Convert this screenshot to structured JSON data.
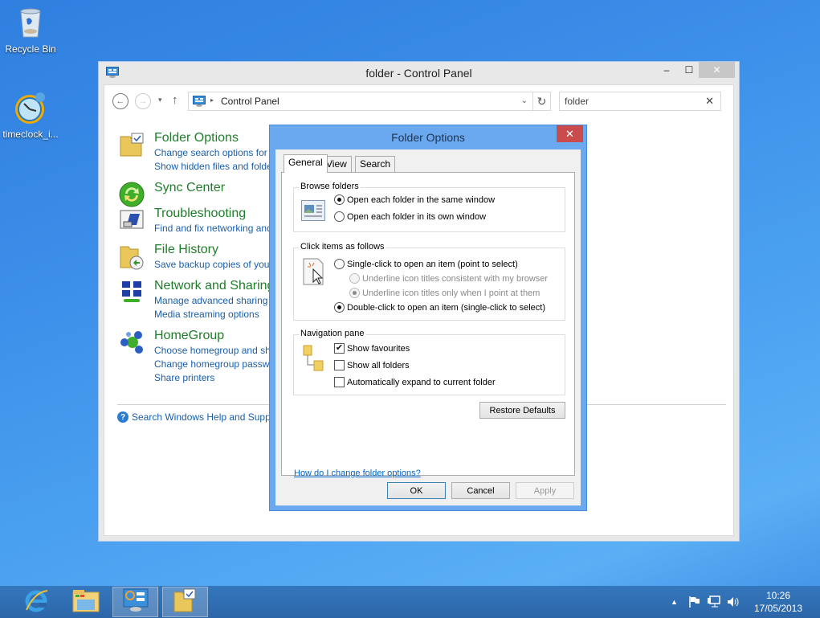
{
  "desktop": {
    "icons": [
      {
        "label": "Recycle Bin",
        "icon": "recycle-bin-icon"
      },
      {
        "label": "timeclock_i...",
        "icon": "clock-app-icon"
      }
    ]
  },
  "control_panel": {
    "title": "folder - Control Panel",
    "icon": "control-panel-icon",
    "window_buttons": {
      "minimize": "‒",
      "maximize": "☐",
      "close": "✕"
    },
    "nav": {
      "back": "←",
      "forward": "→",
      "recent": "▾",
      "up": "↑",
      "breadcrumb_sep": "▸",
      "address": "Control Panel",
      "address_dropdown": "⌄",
      "refresh": "↻"
    },
    "search": {
      "value": "folder",
      "clear": "✕"
    },
    "results": [
      {
        "title": "Folder Options",
        "icon": "folder-options-icon",
        "links": [
          "Change search options for files and folders",
          "Show hidden files and folders"
        ]
      },
      {
        "title": "Sync Center",
        "icon": "sync-center-icon",
        "links": []
      },
      {
        "title": "Troubleshooting",
        "icon": "troubleshooting-icon",
        "links": [
          "Find and fix networking and connection problems"
        ]
      },
      {
        "title": "File History",
        "icon": "file-history-icon",
        "links": [
          "Save backup copies of your files with File History"
        ]
      },
      {
        "title": "Network and Sharing Center",
        "icon": "network-sharing-icon",
        "links": [
          "Manage advanced sharing settings",
          "Media streaming options"
        ]
      },
      {
        "title": "HomeGroup",
        "icon": "homegroup-icon",
        "links": [
          "Choose homegroup and sharing options",
          "Change homegroup password",
          "Share printers"
        ]
      }
    ],
    "help_link": "Search Windows Help and Support for \"folder\""
  },
  "dialog": {
    "title": "Folder Options",
    "close": "✕",
    "tabs": [
      {
        "label": "General",
        "active": true
      },
      {
        "label": "View",
        "active": false
      },
      {
        "label": "Search",
        "active": false
      }
    ],
    "browse_folders": {
      "label": "Browse folders",
      "options": [
        {
          "label": "Open each folder in the same window",
          "checked": true
        },
        {
          "label": "Open each folder in its own window",
          "checked": false
        }
      ]
    },
    "click_items": {
      "label": "Click items as follows",
      "options": [
        {
          "label": "Single-click to open an item (point to select)",
          "checked": false,
          "enabled": true
        },
        {
          "label": "Underline icon titles consistent with my browser",
          "checked": false,
          "enabled": false
        },
        {
          "label": "Underline icon titles only when I point at them",
          "checked": true,
          "enabled": false
        },
        {
          "label": "Double-click to open an item (single-click to select)",
          "checked": true,
          "enabled": true
        }
      ]
    },
    "navigation_pane": {
      "label": "Navigation pane",
      "options": [
        {
          "label": "Show favourites",
          "checked": true
        },
        {
          "label": "Show all folders",
          "checked": false
        },
        {
          "label": "Automatically expand to current folder",
          "checked": false
        }
      ]
    },
    "restore_defaults": "Restore Defaults",
    "help_link": "How do I change folder options?",
    "buttons": {
      "ok": "OK",
      "cancel": "Cancel",
      "apply": "Apply"
    }
  },
  "taskbar": {
    "items": [
      {
        "name": "Internet Explorer",
        "active": false
      },
      {
        "name": "File Explorer",
        "active": false
      },
      {
        "name": "Control Panel",
        "active": true
      },
      {
        "name": "Folder Options",
        "active": true
      }
    ],
    "tray": {
      "show_hidden": "▲",
      "time": "10:26",
      "date": "17/05/2013"
    }
  }
}
